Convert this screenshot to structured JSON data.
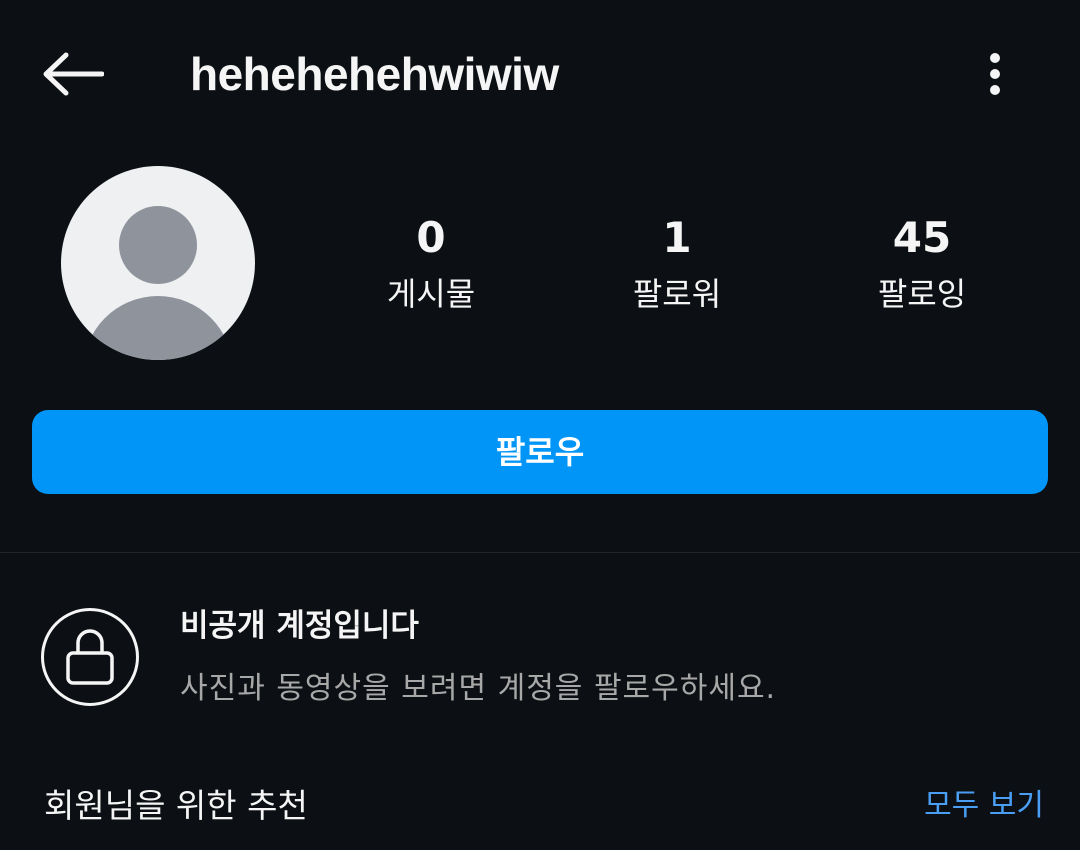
{
  "header": {
    "username": "hehehehehwiwiw",
    "back_icon": "arrow-left-icon",
    "more_icon": "more-vertical-icon"
  },
  "profile": {
    "avatar_icon": "default-avatar-icon",
    "stats": [
      {
        "value": "0",
        "label": "게시물"
      },
      {
        "value": "1",
        "label": "팔로워"
      },
      {
        "value": "45",
        "label": "팔로잉"
      }
    ]
  },
  "actions": {
    "follow_label": "팔로우",
    "follow_color": "#0095f6"
  },
  "private_notice": {
    "icon": "lock-icon",
    "title": "비공개 계정입니다",
    "description": "사진과 동영상을 보려면 계정을 팔로우하세요."
  },
  "suggestions": {
    "title": "회원님을 위한 추천",
    "see_all_label": "모두 보기"
  },
  "colors": {
    "background": "#0c1014",
    "accent": "#0095f6",
    "link": "#4a9ff5",
    "secondary_text": "#a8a8a8"
  }
}
